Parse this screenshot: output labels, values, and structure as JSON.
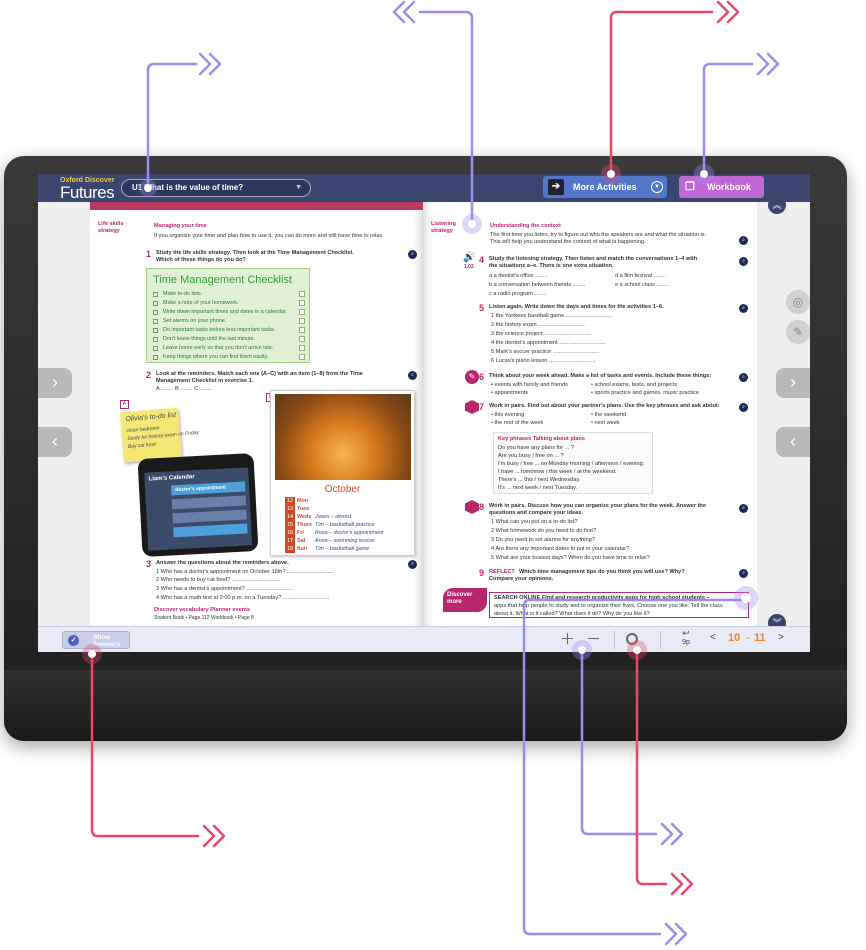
{
  "app": {
    "logo_line1": "Oxford Discover",
    "logo_line2": "Futures",
    "unit_title": "U1 What is the value of time?",
    "more_activities": "More Activities",
    "workbook": "Workbook",
    "show_answers_line1": "Show",
    "show_answers_line2": "Answers",
    "go_page_label": "9p",
    "page_left": "10",
    "page_sep": "-",
    "page_right": "11",
    "prev": "<",
    "next": ">"
  },
  "left_page": {
    "strategy_label_1": "Life skills",
    "strategy_label_2": "strategy",
    "strategy_title": "Managing your time",
    "strategy_text": "If you organize your time and plan how to use it, you can do more and still have time to relax.",
    "ex1_num": "1",
    "ex1_line1": "Study the life skills strategy. Then look at the Time Management Checklist.",
    "ex1_line2": "Which of these things do you do?",
    "checklist_title": "Time Management Checklist",
    "checklist_items": [
      "Make to-do lists.",
      "Make a note of your homework.",
      "Write down important times and dates in a calendar.",
      "Set alarms on your phone.",
      "Do important tasks before less important tasks.",
      "Don't leave things until the last minute.",
      "Leave home early so that you don't arrive late.",
      "Keep things where you can find them easily."
    ],
    "ex2_num": "2",
    "ex2_line1": "Look at the reminders. Match each one (A–C) with an item (1–8) from the Time",
    "ex2_line2": "Management Checklist in exercise 1.",
    "ex2_blanks": "A ........     B ........     C ........",
    "sticky_title": "Olivia's to-do list",
    "sticky_l1": "clean bedroom",
    "sticky_l2": "Study for history exam on Friday",
    "sticky_l3": "Buy cat food",
    "phone_title": "Liam's Calendar",
    "phone_bar1": "doctor's appointment",
    "tag_a": "A",
    "tag_b": "B",
    "tag_c": "C",
    "cal_month": "October",
    "cal_rows": [
      {
        "d": "12",
        "w": "Mon",
        "n": ""
      },
      {
        "d": "13",
        "w": "Tues",
        "n": ""
      },
      {
        "d": "14",
        "w": "Weds",
        "n": "Jason – dentist"
      },
      {
        "d": "15",
        "w": "Thurs",
        "n": "Tim – basketball practice"
      },
      {
        "d": "16",
        "w": "Fri",
        "n": "Rosa – doctor's appointment"
      },
      {
        "d": "17",
        "w": "Sat",
        "n": "Anna – swimming lesson"
      },
      {
        "d": "18",
        "w": "Sun",
        "n": "Tim – basketball game"
      }
    ],
    "ex3_num": "3",
    "ex3_line": "Answer the questions about the reminders above.",
    "ex3_q": [
      "1   Who has a doctor's appointment on October 16th? ..............................",
      "2   Who needs to buy cat food? ..............................",
      "3   Who has a dentist's appointment? ..............................",
      "4   Who has a math test at 2:00 p.m. on a Tuesday? .............................."
    ],
    "discover_vocab": "Discover vocabulary Planner events",
    "sb_ref": "Student Book • Page 112          Workbook • Page 8"
  },
  "right_page": {
    "strategy_label_1": "Listening",
    "strategy_label_2": "strategy",
    "strategy_title": "Understanding the context",
    "strategy_text_1": "The first time you listen, try to figure out who the speakers are and what the situation is.",
    "strategy_text_2": "This will help you understand the context of what is happening.",
    "audio_track": "1.02",
    "ex4_num": "4",
    "ex4_line1": "Study the listening strategy. Then listen and match the conversations 1–4 with",
    "ex4_line2": "the situations a–e. There is one extra situation.",
    "ex4_a": "a   a dentist's office ........",
    "ex4_b": "b   a conversation between friends ........",
    "ex4_c": "c   a radio program ........",
    "ex4_d": "d   a film festival ........",
    "ex4_e": "e   a school class ........",
    "ex5_num": "5",
    "ex5_line": "Listen again. Write down the days and times for the activities 1–6.",
    "ex5_items": [
      "1   the Yankees baseball game ..............................",
      "2   the history exam ..............................",
      "3   the science project ..............................",
      "4   the dentist's appointment ..............................",
      "5   Mark's soccer practice ..............................",
      "6   Lucas's piano lesson .............................."
    ],
    "ex6_num": "6",
    "ex6_line": "Think about your week ahead. Make a list of tasks and events. Include these things:",
    "ex6_b1": "•  events with family and friends",
    "ex6_b2": "•  appointments",
    "ex6_b3": "•  school exams, tests, and projects",
    "ex6_b4": "•  sports practice and games, music practice",
    "ex7_num": "7",
    "ex7_line": "Work in pairs. Find out about your partner's plans. Use the key phrases and ask about:",
    "ex7_b1": "•  this evening",
    "ex7_b2": "•  the rest of the week",
    "ex7_b3": "•  the weekend",
    "ex7_b4": "•  next week",
    "kp_title": "Key phrases Talking about plans",
    "kp_lines": [
      "Do you have any plans for ... ?",
      "Are you busy / free on ... ?",
      "I'm busy / free ... on Monday morning / afternoon / evening.",
      "I have ... tomorrow / this week / at the weekend.",
      "There's ... this / next Wednesday.",
      "It's ... next week / next Tuesday."
    ],
    "ex8_num": "8",
    "ex8_line1": "Work in pairs. Discuss how you can organize your plans for the week. Answer the",
    "ex8_line2": "questions and compare your ideas.",
    "ex8_items": [
      "1   What can you put on a to-do list?",
      "2   What homework do you need to do first?",
      "3   Do you need to set alarms for anything?",
      "4   Are there any important dates to put in your calendar?",
      "5   What are your busiest days? When do you have time to relax?"
    ],
    "ex9_num": "9",
    "ex9_reflect": "REFLECT",
    "ex9_line1": "Which time management tips do you think you will use? Why?",
    "ex9_line2": "Compare your opinions.",
    "discover_more_1": "Discover",
    "discover_more_2": "more",
    "search_online_1": "SEARCH ONLINE  Find and research productivity apps for high school students –",
    "search_online_2": "apps that help people to study and to organize their lives. Choose one you like. Tell the class",
    "search_online_3": "about it. What is it called? What does it do? Why do you like it?"
  },
  "colors": {
    "topbar": "#3a4670",
    "more_activities": "#5276c9",
    "workbook": "#c069d6",
    "accent_magenta": "#b8266e",
    "callout_purple": "#9b8cf0",
    "callout_red": "#e8496b",
    "page_number": "#e68a1e"
  },
  "icons": [
    "arrow-right-icon",
    "arrow-left-icon",
    "chevron-up-icon",
    "chevron-down-icon",
    "magnifier-icon",
    "pen-icon",
    "target-icon",
    "check-icon",
    "workbook-icon",
    "exit-icon",
    "audio-icon"
  ]
}
